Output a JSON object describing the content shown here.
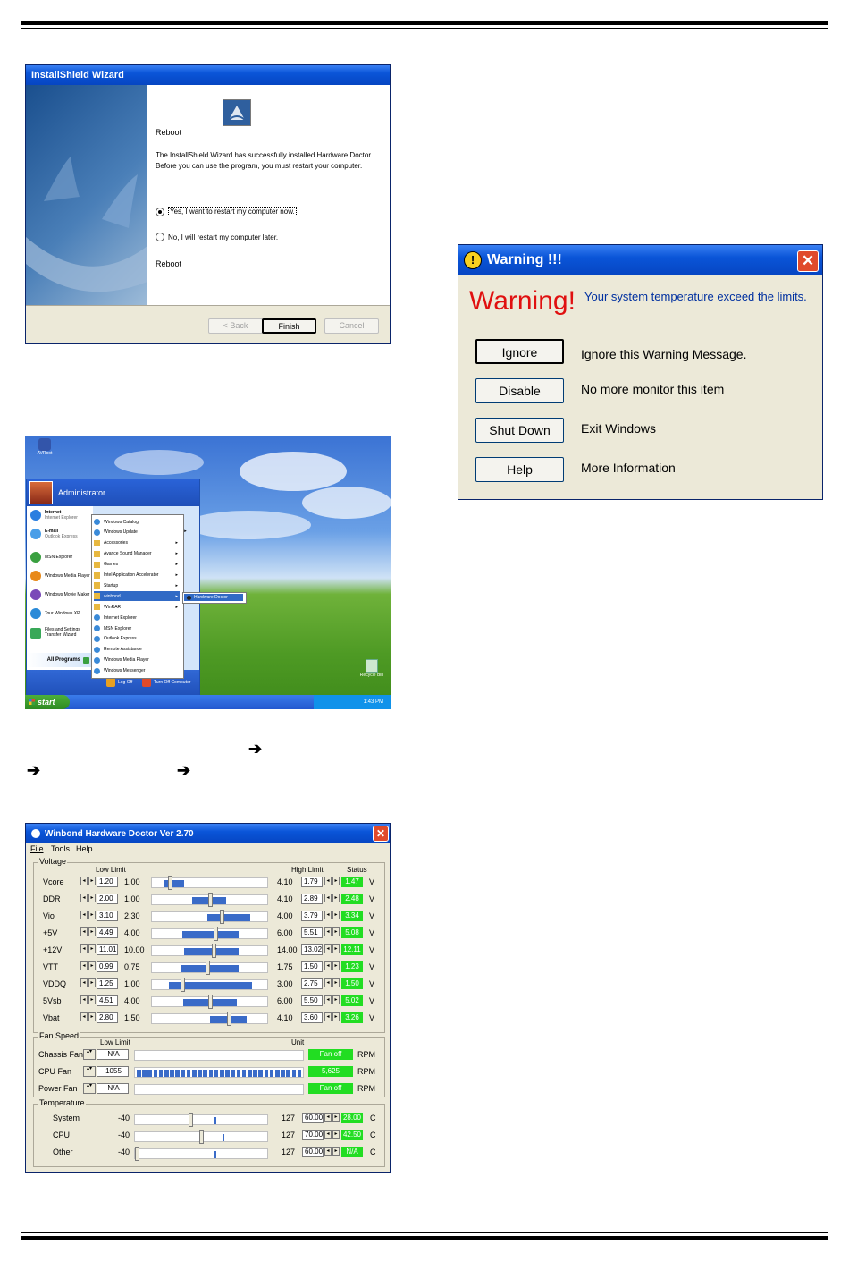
{
  "wizard": {
    "title": "InstallShield Wizard",
    "heading": "Reboot",
    "message": "The InstallShield Wizard has successfully installed Hardware Doctor.  Before you can use the program, you must restart your computer.",
    "option_yes": "Yes, I want to restart my computer now.",
    "option_no": "No, I will restart my computer later.",
    "footer_text": "Reboot",
    "back": "< Back",
    "finish": "Finish",
    "cancel": "Cancel"
  },
  "desktop": {
    "desktop_icon_label": "AVRoot",
    "user": "Administrator",
    "pinned": [
      {
        "title": "Internet",
        "sub": "Internet Explorer"
      },
      {
        "title": "E-mail",
        "sub": "Outlook Express"
      }
    ],
    "recent": [
      "MSN Explorer",
      "Windows Media Player",
      "Windows Movie Maker",
      "Tour Windows XP",
      "Files and Settings Transfer Wizard"
    ],
    "all_programs": "All Programs",
    "right_arrow": "ts ▸",
    "programs": [
      "Windows Catalog",
      "Windows Update",
      "Accessories",
      "Avance Sound Manager",
      "Games",
      "Intel Application Accelerator",
      "Startup",
      "winbond",
      "WinRAR",
      "Internet Explorer",
      "MSN Explorer",
      "Outlook Express",
      "Remote Assistance",
      "Windows Media Player",
      "Windows Messenger"
    ],
    "submenu_item": "Hardware Doctor",
    "log_off": "Log Off",
    "turn_off": "Turn Off Computer",
    "start": "start",
    "recycle_bin": "Recycle Bin",
    "clock": "1:43 PM"
  },
  "warning": {
    "title": "Warning !!!",
    "big": "Warning!",
    "message": "Your system temperature exceed the limits.",
    "buttons": [
      {
        "label": "Ignore",
        "desc": "Ignore this Warning Message."
      },
      {
        "label": "Disable",
        "desc": "No more monitor this item"
      },
      {
        "label": "Shut Down",
        "desc": "Exit Windows"
      },
      {
        "label": "Help",
        "desc": "More Information"
      }
    ]
  },
  "arrow_glyph": "➔",
  "hwd": {
    "title": "Winbond Hardware Doctor Ver 2.70",
    "menu": [
      "File",
      "Tools",
      "Help"
    ],
    "voltage": {
      "title": "Voltage",
      "low_header": "Low Limit",
      "high_header": "High Limit",
      "status_header": "Status",
      "rows": [
        {
          "name": "Vcore",
          "low": "1.20",
          "min": "1.00",
          "max": "4.10",
          "high": "1.79",
          "status": "1.47",
          "unit": "V",
          "thumb": 0.14,
          "bar": [
            0.1,
            0.28
          ]
        },
        {
          "name": "DDR",
          "low": "2.00",
          "min": "1.00",
          "max": "4.10",
          "high": "2.89",
          "status": "2.48",
          "unit": "V",
          "thumb": 0.5,
          "bar": [
            0.35,
            0.64
          ]
        },
        {
          "name": "Vio",
          "low": "3.10",
          "min": "2.30",
          "max": "4.00",
          "high": "3.79",
          "status": "3.34",
          "unit": "V",
          "thumb": 0.6,
          "bar": [
            0.48,
            0.85
          ]
        },
        {
          "name": "+5V",
          "low": "4.49",
          "min": "4.00",
          "max": "6.00",
          "high": "5.51",
          "status": "5.08",
          "unit": "V",
          "thumb": 0.55,
          "bar": [
            0.26,
            0.75
          ]
        },
        {
          "name": "+12V",
          "low": "11.01",
          "min": "10.00",
          "max": "14.00",
          "high": "13.02",
          "status": "12.11",
          "unit": "V",
          "thumb": 0.53,
          "bar": [
            0.28,
            0.75
          ]
        },
        {
          "name": "VTT",
          "low": "0.99",
          "min": "0.75",
          "max": "1.75",
          "high": "1.50",
          "status": "1.23",
          "unit": "V",
          "thumb": 0.48,
          "bar": [
            0.25,
            0.75
          ]
        },
        {
          "name": "VDDQ",
          "low": "1.25",
          "min": "1.00",
          "max": "3.00",
          "high": "2.75",
          "status": "1.50",
          "unit": "V",
          "thumb": 0.25,
          "bar": [
            0.15,
            0.87
          ]
        },
        {
          "name": "5Vsb",
          "low": "4.51",
          "min": "4.00",
          "max": "6.00",
          "high": "5.50",
          "status": "5.02",
          "unit": "V",
          "thumb": 0.5,
          "bar": [
            0.27,
            0.74
          ]
        },
        {
          "name": "Vbat",
          "low": "2.80",
          "min": "1.50",
          "max": "4.10",
          "high": "3.60",
          "status": "3.26",
          "unit": "V",
          "thumb": 0.67,
          "bar": [
            0.5,
            0.82
          ]
        }
      ]
    },
    "fan": {
      "title": "Fan Speed",
      "low_header": "Low Limit",
      "unit_header": "Unit",
      "rows": [
        {
          "name": "Chassis Fan",
          "low": "N/A",
          "status": "Fan off",
          "unit": "RPM",
          "fill": 0
        },
        {
          "name": "CPU Fan",
          "low": "1055",
          "status": "5,625",
          "unit": "RPM",
          "fill": 1
        },
        {
          "name": "Power Fan",
          "low": "N/A",
          "status": "Fan off",
          "unit": "RPM",
          "fill": 0
        }
      ]
    },
    "temperature": {
      "title": "Temperature",
      "rows": [
        {
          "name": "System",
          "min": "-40",
          "max": "127",
          "high": "60.00",
          "status": "28.00",
          "unit": "C",
          "thumb": 0.42,
          "mark": 0.6
        },
        {
          "name": "CPU",
          "min": "-40",
          "max": "127",
          "high": "70.00",
          "status": "42.50",
          "unit": "C",
          "thumb": 0.5,
          "mark": 0.66
        },
        {
          "name": "Other",
          "min": "-40",
          "max": "127",
          "high": "60.00",
          "status": "N/A",
          "unit": "C",
          "thumb": 0.0,
          "mark": 0.6
        }
      ]
    }
  }
}
